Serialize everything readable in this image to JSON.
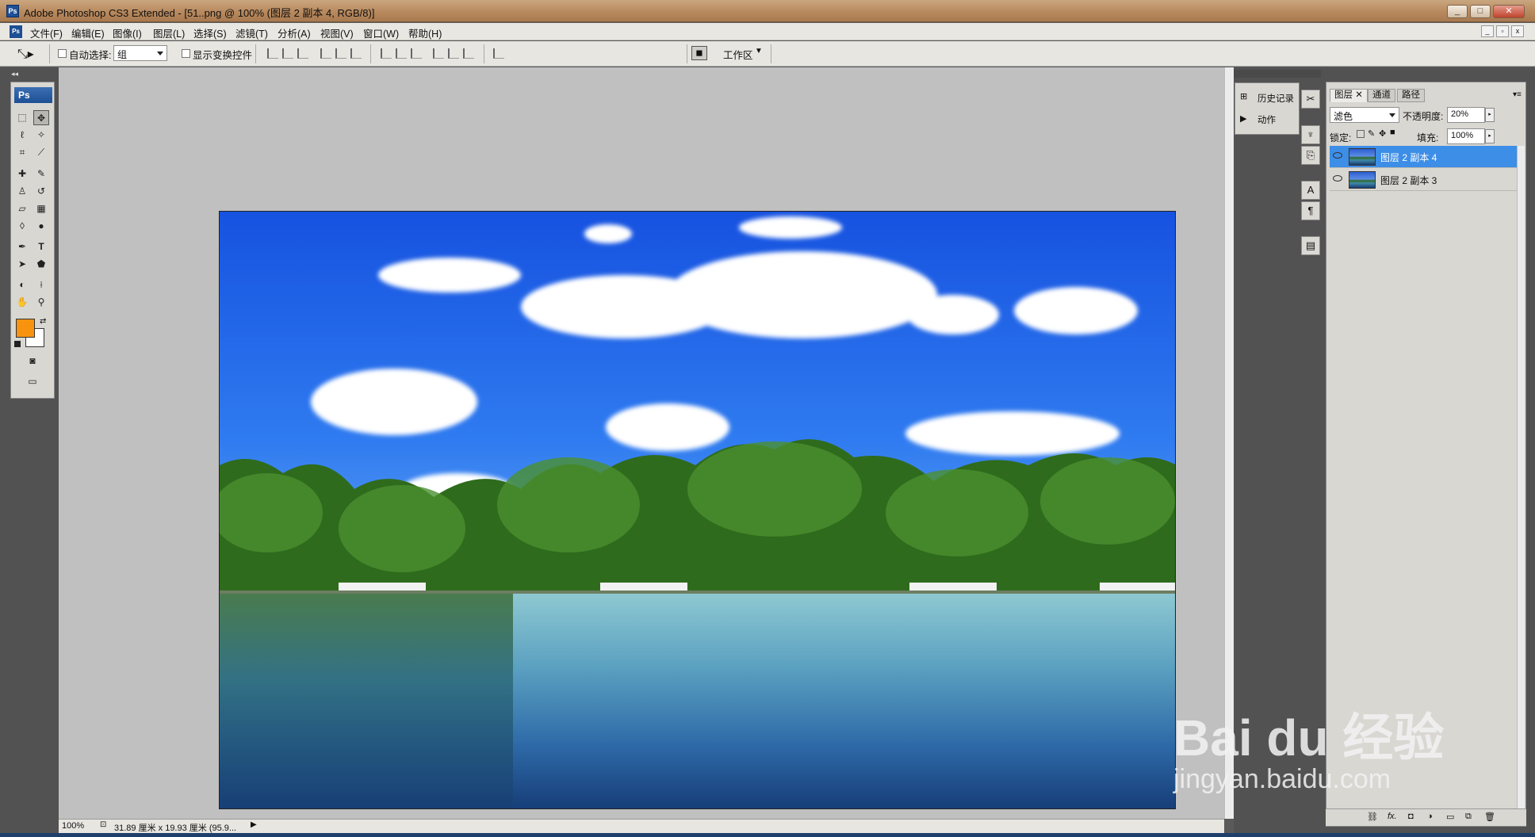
{
  "window": {
    "title": "Adobe Photoshop CS3 Extended - [51..png @ 100% (图层 2 副本 4, RGB/8)]",
    "app_icon_text": "Ps",
    "min_label": "_",
    "max_label": "□",
    "close_label": "✕",
    "doc_btns": [
      "_",
      "▫",
      "x"
    ]
  },
  "menu": {
    "items": [
      "文件(F)",
      "编辑(E)",
      "图像(I)",
      "图层(L)",
      "选择(S)",
      "滤镜(T)",
      "分析(A)",
      "视图(V)",
      "窗口(W)",
      "帮助(H)"
    ]
  },
  "options": {
    "auto_select_label": "自动选择:",
    "auto_select_value": "组",
    "show_transform_label": "显示变换控件",
    "workspace_label": "工作区"
  },
  "toolbox": {
    "logo": "Ps",
    "foreground_color": "#f7930e",
    "background_color": "#ffffff"
  },
  "status": {
    "zoom": "100%",
    "doc_info": "31.89 厘米 x 19.93 厘米 (95.9..."
  },
  "history_panel": {
    "items": [
      "历史记录",
      "动作"
    ]
  },
  "layers_panel": {
    "tabs": [
      "图层",
      "通道",
      "路径"
    ],
    "blend_mode": "滤色",
    "opacity_label": "不透明度:",
    "opacity_value": "20%",
    "lock_label": "锁定:",
    "fill_label": "填充:",
    "fill_value": "100%",
    "layers": [
      {
        "name": "图层 2 副本 4",
        "selected": true
      },
      {
        "name": "图层 2 副本 3",
        "selected": false
      }
    ],
    "bottom_icons": [
      "link-icon",
      "fx-icon",
      "mask-icon",
      "adjustment-icon",
      "group-icon",
      "new-layer-icon",
      "trash-icon"
    ]
  },
  "watermark": {
    "brand": "Bai du 经验",
    "url": "jingyan.baidu.com"
  }
}
